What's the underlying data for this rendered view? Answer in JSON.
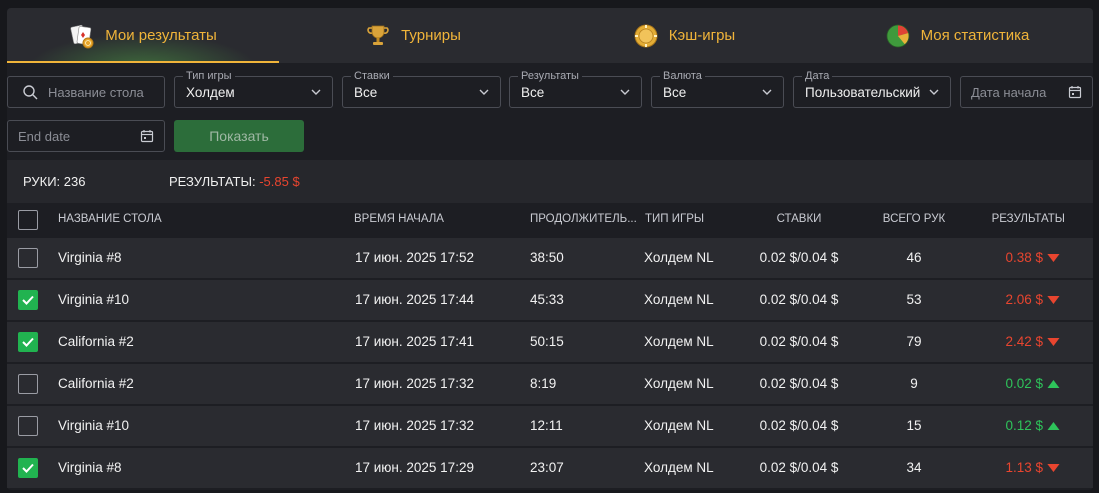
{
  "tabs": [
    {
      "label": "Мои результаты",
      "icon": "cards-icon",
      "active": true
    },
    {
      "label": "Турниры",
      "icon": "trophy-icon",
      "active": false
    },
    {
      "label": "Кэш-игры",
      "icon": "chip-icon",
      "active": false
    },
    {
      "label": "Моя статистика",
      "icon": "pie-chart-icon",
      "active": false
    }
  ],
  "filters": {
    "search_placeholder": "Название стола",
    "game_type": {
      "label": "Тип игры",
      "value": "Холдем"
    },
    "stakes": {
      "label": "Ставки",
      "value": "Все"
    },
    "results": {
      "label": "Результаты",
      "value": "Все"
    },
    "currency": {
      "label": "Валюта",
      "value": "Все"
    },
    "date": {
      "label": "Дата",
      "value": "Пользовательский"
    },
    "start_date_placeholder": "Дата начала",
    "end_date_placeholder": "End date",
    "show_label": "Показать"
  },
  "summary": {
    "hands_label": "РУКИ:",
    "hands_value": "236",
    "results_label": "РЕЗУЛЬТАТЫ:",
    "results_value": "-5.85 $"
  },
  "table": {
    "headers": {
      "name": "Название стола",
      "start": "Время начала",
      "duration": "Продолжитель...",
      "game": "Тип игры",
      "stakes": "Ставки",
      "hands": "Всего рук",
      "result": "Результаты"
    },
    "rows": [
      {
        "checked": false,
        "name": "Virginia #8",
        "start": "17 июн. 2025 17:52",
        "duration": "38:50",
        "game": "Холдем NL",
        "stakes": "0.02 $/0.04 $",
        "hands": "46",
        "result": "0.38 $",
        "trend": "down"
      },
      {
        "checked": true,
        "name": "Virginia #10",
        "start": "17 июн. 2025 17:44",
        "duration": "45:33",
        "game": "Холдем NL",
        "stakes": "0.02 $/0.04 $",
        "hands": "53",
        "result": "2.06 $",
        "trend": "down"
      },
      {
        "checked": true,
        "name": "California #2",
        "start": "17 июн. 2025 17:41",
        "duration": "50:15",
        "game": "Холдем NL",
        "stakes": "0.02 $/0.04 $",
        "hands": "79",
        "result": "2.42 $",
        "trend": "down"
      },
      {
        "checked": false,
        "name": "California #2",
        "start": "17 июн. 2025 17:32",
        "duration": "8:19",
        "game": "Холдем NL",
        "stakes": "0.02 $/0.04 $",
        "hands": "9",
        "result": "0.02 $",
        "trend": "up"
      },
      {
        "checked": false,
        "name": "Virginia #10",
        "start": "17 июн. 2025 17:32",
        "duration": "12:11",
        "game": "Холдем NL",
        "stakes": "0.02 $/0.04 $",
        "hands": "15",
        "result": "0.12 $",
        "trend": "up"
      },
      {
        "checked": true,
        "name": "Virginia #8",
        "start": "17 июн. 2025 17:29",
        "duration": "23:07",
        "game": "Холдем NL",
        "stakes": "0.02 $/0.04 $",
        "hands": "34",
        "result": "1.13 $",
        "trend": "down"
      }
    ]
  },
  "colors": {
    "accent": "#f0b43a",
    "negative": "#e8452f",
    "positive": "#2ec35a",
    "checkbox": "#21b350"
  }
}
